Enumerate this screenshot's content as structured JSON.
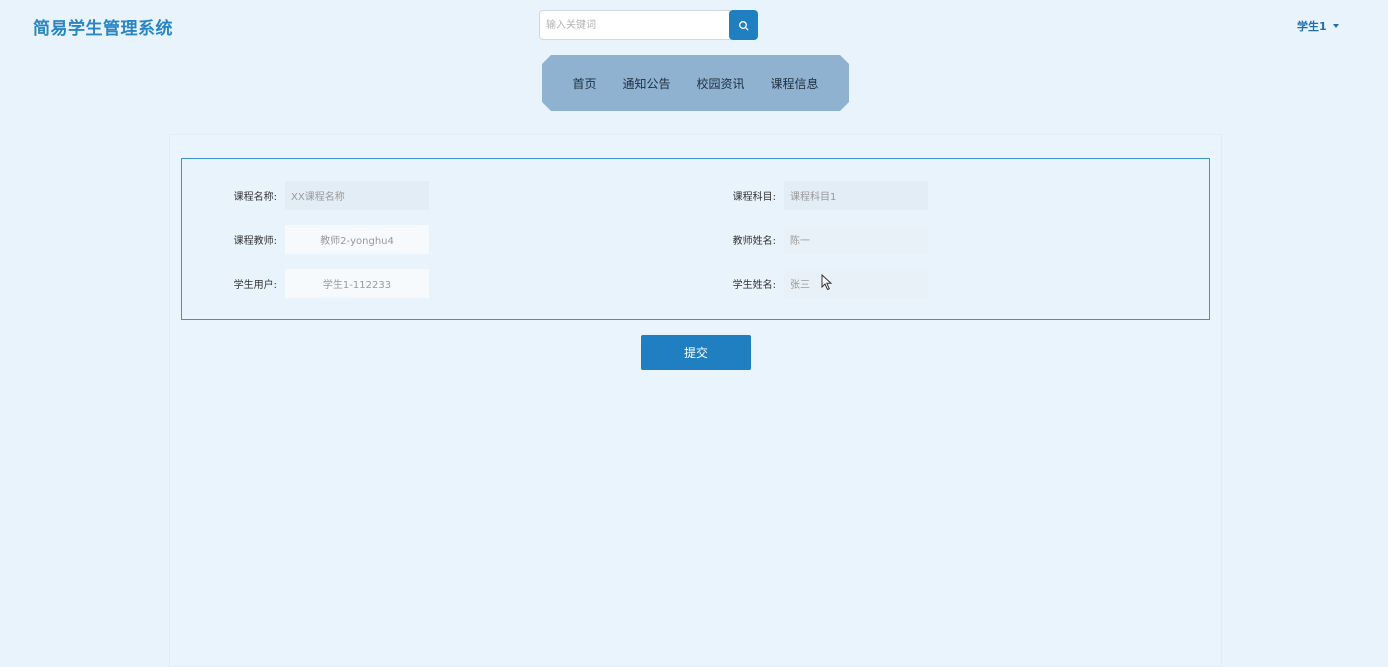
{
  "app": {
    "title": "简易学生管理系统"
  },
  "search": {
    "placeholder": "输入关键词",
    "icon": "search-icon"
  },
  "user_menu": {
    "label": "学生1"
  },
  "nav": {
    "items": [
      {
        "label": "首页"
      },
      {
        "label": "通知公告"
      },
      {
        "label": "校园资讯"
      },
      {
        "label": "课程信息"
      }
    ]
  },
  "form": {
    "course_name": {
      "label": "课程名称:",
      "value": "XX课程名称"
    },
    "course_subject": {
      "label": "课程科目:",
      "value": "课程科目1"
    },
    "course_teacher": {
      "label": "课程教师:",
      "value": "教师2-yonghu4"
    },
    "teacher_name": {
      "label": "教师姓名:",
      "value": "陈一"
    },
    "student_user": {
      "label": "学生用户:",
      "value": "学生1-112233"
    },
    "student_name": {
      "label": "学生姓名:",
      "value": "张三"
    }
  },
  "submit": {
    "label": "提交"
  },
  "colors": {
    "accent": "#1f7fc0",
    "brand": "#2a86c2",
    "nav_bg": "#8fb2d1",
    "page_bg": "#e9f3fc"
  }
}
